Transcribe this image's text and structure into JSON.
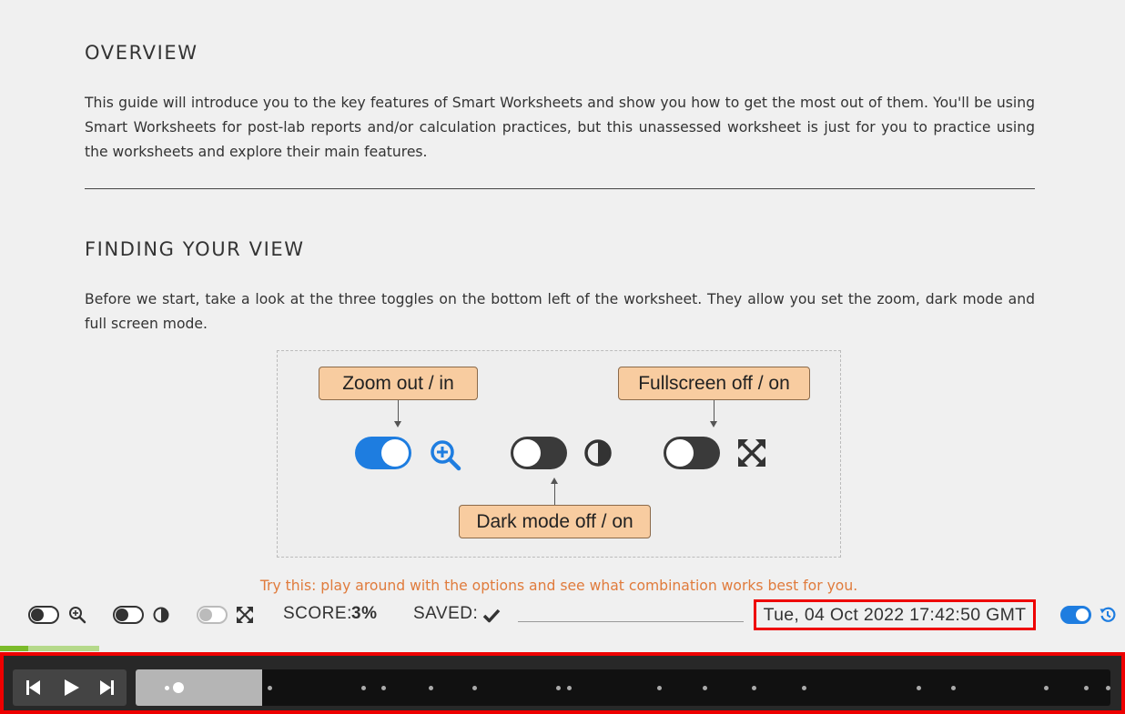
{
  "overview": {
    "heading": "OVERVIEW",
    "body": "This guide will introduce you to the key features of Smart Worksheets and show you how to get the most out of them. You'll be using Smart Worksheets for post-lab reports and/or calculation practices, but this unassessed worksheet is just for you to practice using the worksheets and explore their main features."
  },
  "finding_view": {
    "heading": "FINDING YOUR VIEW",
    "body": "Before we start, take a look at the three toggles on the bottom left of the worksheet. They allow you set the zoom, dark mode and full screen mode.",
    "figure": {
      "zoom_label": "Zoom out / in",
      "fullscreen_label": "Fullscreen off / on",
      "darkmode_label": "Dark mode off / on",
      "toggles": [
        {
          "name": "zoom",
          "state": "on",
          "icon": "zoom-in-icon"
        },
        {
          "name": "dark-mode",
          "state": "off",
          "icon": "contrast-icon"
        },
        {
          "name": "fullscreen",
          "state": "off",
          "icon": "expand-icon"
        }
      ]
    },
    "tip": "Try this: play around with the options and see what combination works best for you."
  },
  "toolbar": {
    "zoom_toggle": {
      "state": "off",
      "icon": "zoom-in-icon"
    },
    "dark_toggle": {
      "state": "off",
      "icon": "contrast-icon"
    },
    "fullscreen_toggle": {
      "state": "disabled",
      "icon": "expand-icon"
    },
    "score_label": "SCORE:",
    "score_value": "3%",
    "saved_label": "SAVED:",
    "saved_icon": "checkmark-icon",
    "datetime": "Tue, 04 Oct 2022 17:42:50 GMT",
    "history_toggle": {
      "state": "on",
      "icon": "history-icon"
    }
  },
  "progress": {
    "fraction": 0.28
  },
  "player": {
    "buttons": [
      "skip-back-icon",
      "play-icon",
      "skip-forward-icon"
    ],
    "played_fraction": 0.13
  },
  "colors": {
    "accent": "#1e7de0",
    "callout": "#f8cca0",
    "tip": "#e07b3c",
    "highlight": "#e00000",
    "progress": "#7bbb2a"
  }
}
